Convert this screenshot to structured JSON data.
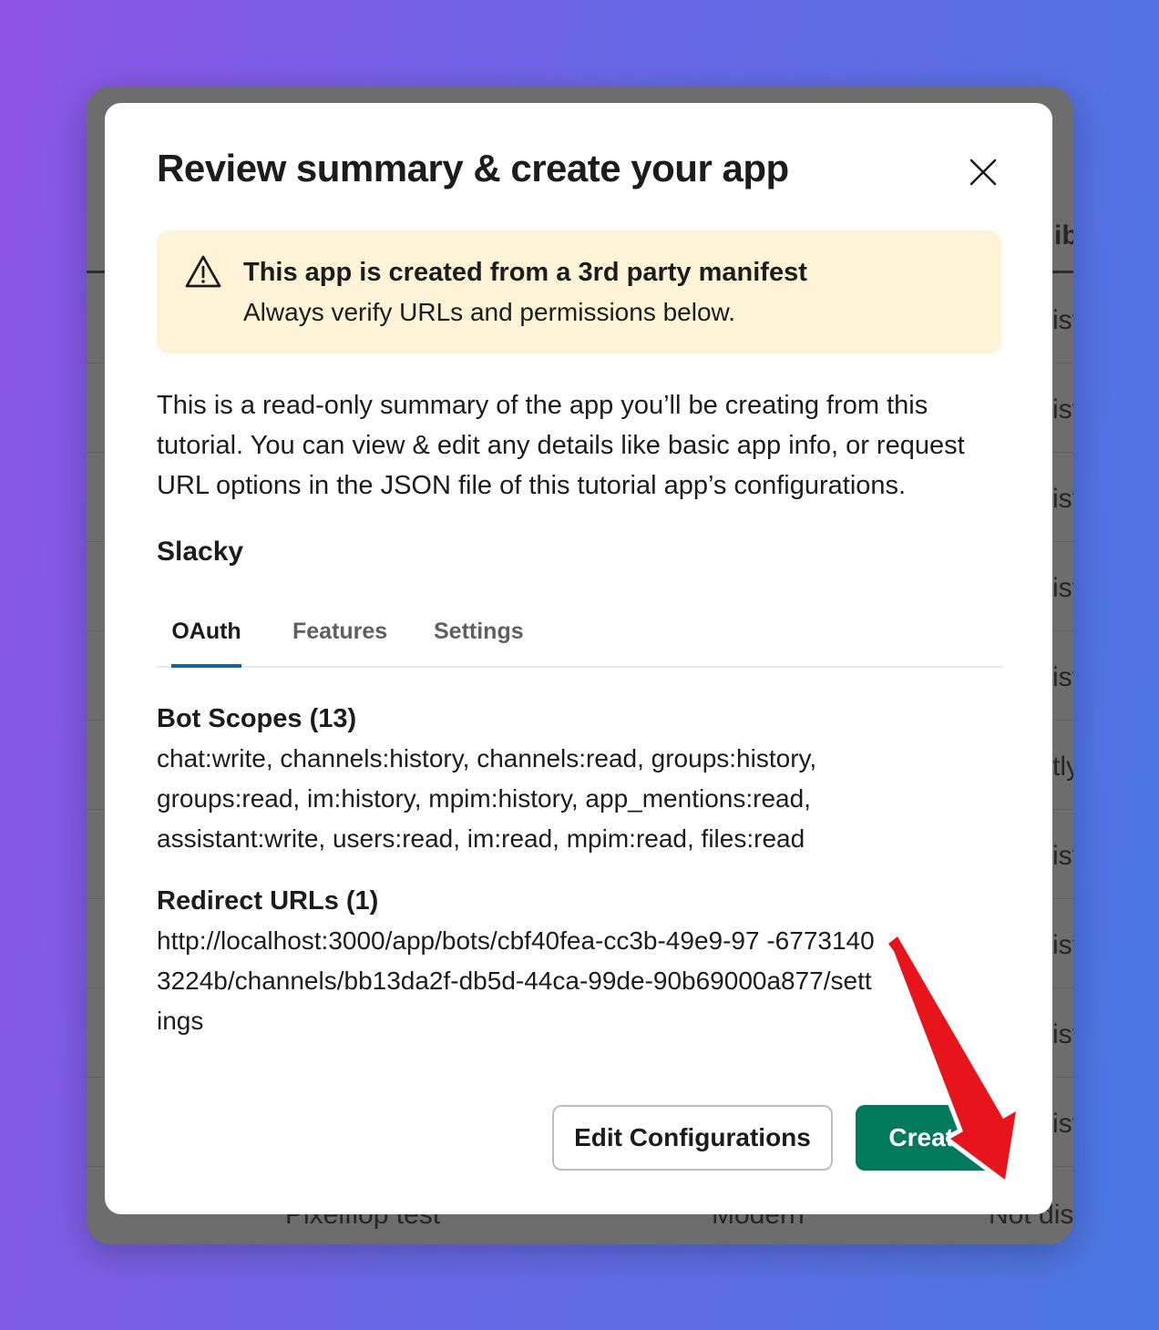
{
  "background": {
    "right_column": [
      "ib",
      "ist",
      "ist",
      "ist",
      "ist",
      "ist",
      "tly",
      "ist",
      "ist",
      "ist",
      "ist"
    ],
    "bottom_row": [
      "Pixelflop test",
      "Modern",
      "Not dist"
    ]
  },
  "modal": {
    "title": "Review summary & create your app",
    "close_icon": "close-icon",
    "warning": {
      "icon": "warning-icon",
      "title": "This app is created from a 3rd party manifest",
      "subtitle": "Always verify URLs and permissions below.",
      "background_color": "#fdf4d7"
    },
    "summary": "This is a read-only summary of the app you’ll be creating from this tutorial. You can view & edit any details like basic app info, or request URL options in the JSON file of this tutorial app’s configurations.",
    "app_name": "Slacky",
    "tabs": [
      {
        "label": "OAuth",
        "active": true
      },
      {
        "label": "Features",
        "active": false
      },
      {
        "label": "Settings",
        "active": false
      }
    ],
    "bot_scopes": {
      "title": "Bot Scopes (13)",
      "value": "chat:write, channels:history, channels:read, groups:history, groups:read, im:history, mpim:history, app_mentions:read, assistant:write, users:read, im:read, mpim:read, files:read"
    },
    "redirect_urls": {
      "title": "Redirect URLs (1)",
      "value": "http://localhost:3000/app/bots/cbf40fea-cc3b-49e9-97 -67731403224b/channels/bb13da2f-db5d-44ca-99de-90b69000a877/settings"
    },
    "buttons": {
      "edit_label": "Edit Configurations",
      "create_label": "Create",
      "create_color": "#007a5a"
    }
  },
  "annotation": {
    "arrow_color": "#e8141c"
  }
}
